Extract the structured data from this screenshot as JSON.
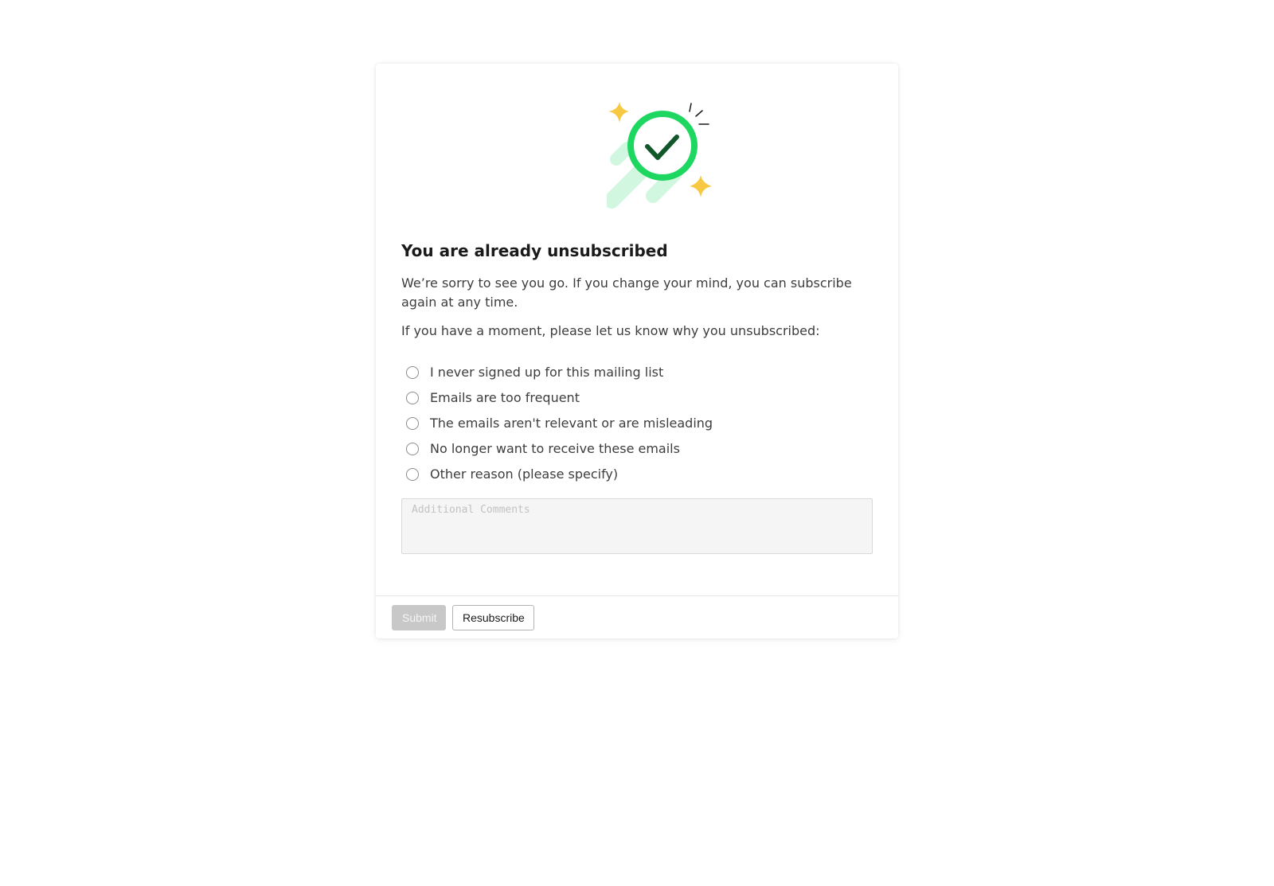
{
  "page": {
    "heading": "You are already unsubscribed",
    "message": "We’re sorry to see you go. If you change your mind, you can subscribe again at any time.",
    "prompt": "If you have a moment, please let us know why you unsubscribed:"
  },
  "hero": {
    "icon": "check-circle-icon",
    "ring_color": "#1ed760",
    "check_color": "#12572a",
    "sparkle_color": "#f7c842",
    "trail_color": "#d2f7e0"
  },
  "reasons": [
    {
      "label": "I never signed up for this mailing list",
      "selected": false
    },
    {
      "label": "Emails are too frequent",
      "selected": false
    },
    {
      "label": "The emails aren't relevant or are misleading",
      "selected": false
    },
    {
      "label": "No longer want to receive these emails",
      "selected": false
    },
    {
      "label": "Other reason (please specify)",
      "selected": false
    }
  ],
  "comments": {
    "placeholder": "Additional Comments",
    "value": ""
  },
  "actions": {
    "submit_label": "Submit",
    "submit_disabled": true,
    "resubscribe_label": "Resubscribe"
  }
}
